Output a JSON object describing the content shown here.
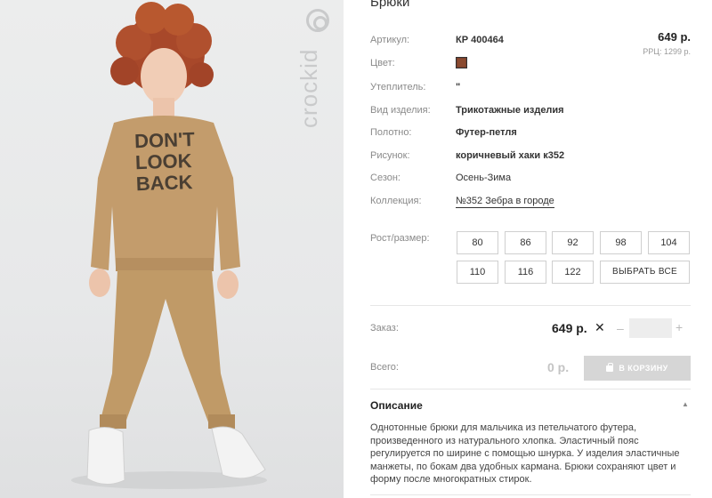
{
  "photo": {
    "brand_text": "crockid",
    "print_text": "DON'T\nLOOK\nBACK"
  },
  "product": {
    "title": "Брюки",
    "price": "649 р.",
    "rrc": "РРЦ: 1299 р."
  },
  "attributes": {
    "article": {
      "label": "Артикул:",
      "value": "КР 400464"
    },
    "color": {
      "label": "Цвет:",
      "swatch": "#7a3f2c"
    },
    "filler": {
      "label": "Утеплитель:",
      "value": "\""
    },
    "kind": {
      "label": "Вид изделия:",
      "value": "Трикотажные изделия"
    },
    "fabric": {
      "label": "Полотно:",
      "value": "Футер-петля"
    },
    "pattern": {
      "label": "Рисунок:",
      "value": "коричневый хаки к352"
    },
    "season": {
      "label": "Сезон:",
      "value": "Осень-Зима"
    },
    "collection": {
      "label": "Коллекция:",
      "value": "№352 Зебра в городе"
    }
  },
  "sizes": {
    "label": "Рост/размер:",
    "options": [
      "80",
      "86",
      "92",
      "98",
      "104",
      "110",
      "116",
      "122"
    ],
    "select_all": "ВЫБРАТЬ ВСЕ"
  },
  "order": {
    "label": "Заказ:",
    "price": "649 р.",
    "times_icon": "✕",
    "minus_icon": "–",
    "plus_icon": "+",
    "quantity": ""
  },
  "total": {
    "label": "Всего:",
    "value": "0 р.",
    "cart_button": "В КОРЗИНУ"
  },
  "description": {
    "title": "Описание",
    "chevron": "▲",
    "text": "Однотонные брюки для мальчика из петельчатого футера, произведенного из натурального хлопка. Эластичный пояс регулируется по ширине с помощью шнурка. У изделия эластичные манжеты, по бокам два удобных кармана. Брюки сохраняют цвет и форму после многократных стирок."
  }
}
